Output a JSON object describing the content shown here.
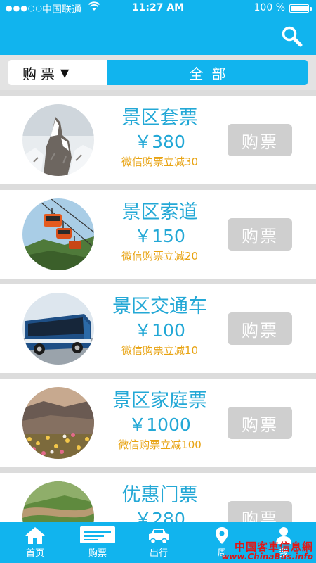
{
  "status_bar": {
    "signal": "●●●○○",
    "carrier": "中国联通",
    "time": "11:27 AM",
    "battery": "100 %"
  },
  "header": {
    "search_icon": "search-icon"
  },
  "filter": {
    "ticket_label": "购票",
    "dropdown_arrow": "▼",
    "all_label": "全部"
  },
  "tickets": [
    {
      "name": "景区套票",
      "price": "￥380",
      "promo": "微信购票立减30",
      "buy_label": "购票",
      "image": "snowy-rock-peak"
    },
    {
      "name": "景区索道",
      "price": "￥150",
      "promo": "微信购票立减20",
      "buy_label": "购票",
      "image": "cable-car"
    },
    {
      "name": "景区交通车",
      "price": "￥100",
      "promo": "微信购票立减10",
      "buy_label": "购票",
      "image": "tour-bus"
    },
    {
      "name": "景区家庭票",
      "price": "￥1000",
      "promo": "微信购票立减100",
      "buy_label": "购票",
      "image": "flower-valley"
    },
    {
      "name": "优惠门票",
      "price": "￥280",
      "buy_label": "购票",
      "image": "mountain-road"
    }
  ],
  "tabbar": {
    "home": "首页",
    "tickets": "购票",
    "travel": "出行",
    "tab4_partial": "周",
    "tab5_partial": "我"
  },
  "watermark": {
    "cn": "中国客車信息網",
    "en": "www.ChinaBus.info"
  },
  "colors": {
    "primary": "#11b4ee",
    "price_text": "#23a8d6",
    "promo_text": "#e8a312",
    "buy_button": "#cfcfcf",
    "watermark": "#e01616"
  }
}
